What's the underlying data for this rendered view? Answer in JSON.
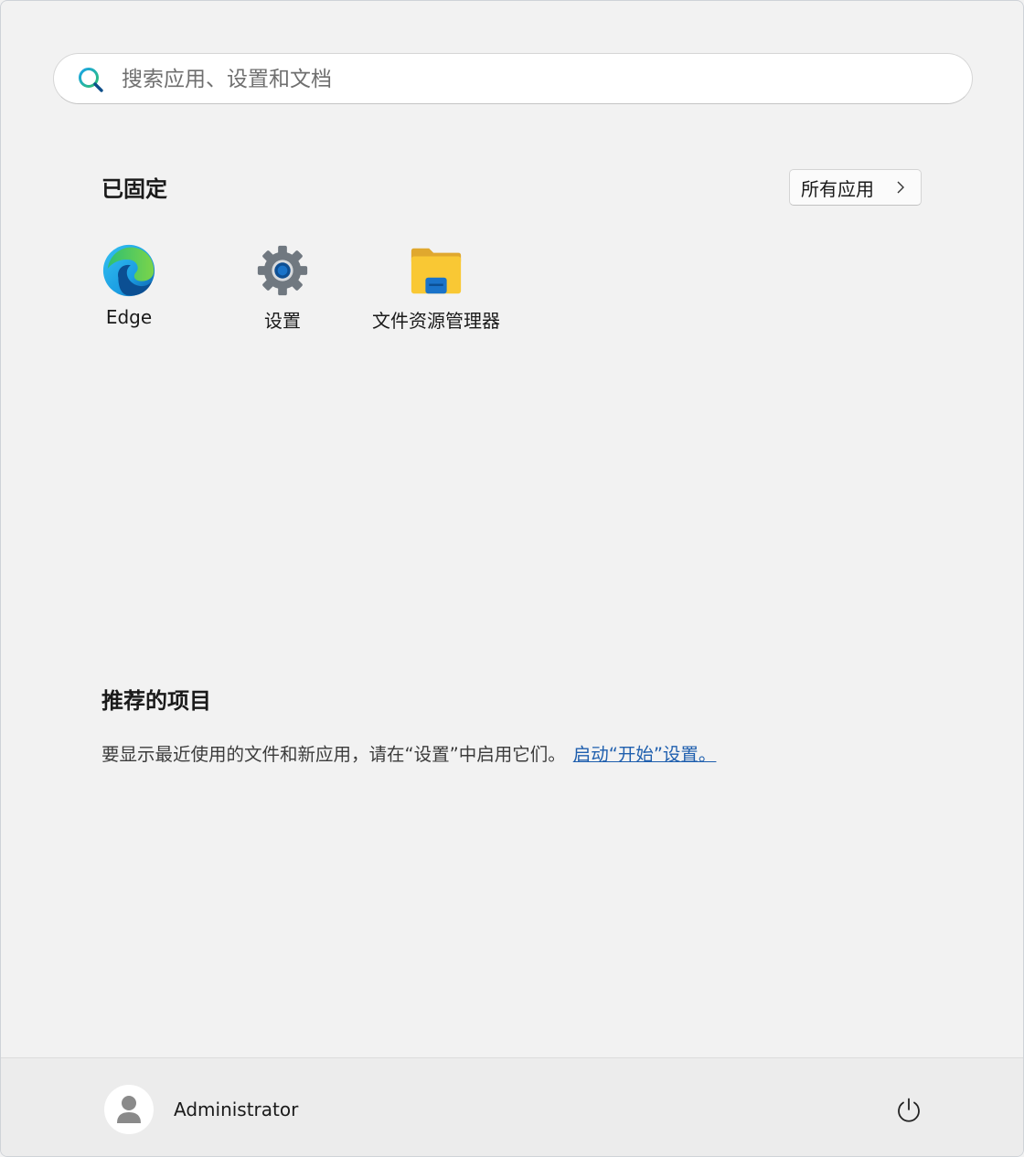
{
  "search": {
    "placeholder": "搜索应用、设置和文档",
    "value": ""
  },
  "pinned": {
    "title": "已固定",
    "all_apps_label": "所有应用",
    "apps": [
      {
        "label": "Edge",
        "icon": "edge-icon"
      },
      {
        "label": "设置",
        "icon": "settings-gear-icon"
      },
      {
        "label": "文件资源管理器",
        "icon": "folder-icon"
      }
    ]
  },
  "recommended": {
    "title": "推荐的项目",
    "message": "要显示最近使用的文件和新应用，请在“设置”中启用它们。",
    "link_label": "启动“开始”设置。"
  },
  "footer": {
    "user_name": "Administrator",
    "avatar_icon": "user-avatar-icon",
    "power_icon": "power-icon"
  },
  "colors": {
    "background": "#f2f2f2",
    "link": "#1f5fae",
    "folder_yellow": "#f9c834",
    "accent_blue": "#0f6cbd"
  }
}
